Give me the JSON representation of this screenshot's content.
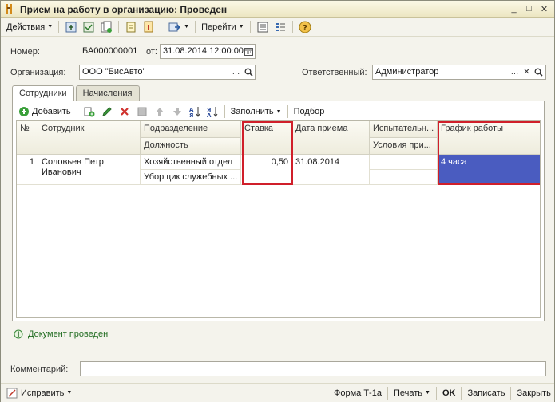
{
  "window": {
    "title": "Прием на работу в организацию: Проведен"
  },
  "toolbar": {
    "actions_label": "Действия",
    "goto_label": "Перейти"
  },
  "form": {
    "number_label": "Номер:",
    "number_value": "БА000000001",
    "date_label": "от:",
    "date_value": "31.08.2014 12:00:00",
    "org_label": "Организация:",
    "org_value": "ООО \"БисАвто\"",
    "resp_label": "Ответственный:",
    "resp_value": "Администратор"
  },
  "tabs": [
    {
      "label": "Сотрудники"
    },
    {
      "label": "Начисления"
    }
  ],
  "table_toolbar": {
    "add_label": "Добавить",
    "fill_label": "Заполнить",
    "select_label": "Подбор"
  },
  "table": {
    "headers": {
      "num": "№",
      "employee": "Сотрудник",
      "department": "Подразделение",
      "position": "Должность",
      "rate": "Ставка",
      "hire_date": "Дата приема",
      "probation": "Испытательн...",
      "conditions": "Условия при...",
      "schedule": "График работы"
    },
    "rows": [
      {
        "num": "1",
        "employee_line1": "Соловьев Петр",
        "employee_line2": "Иванович",
        "department": "Хозяйственный отдел",
        "position": "Уборщик служебных ...",
        "rate": "0,50",
        "hire_date": "31.08.2014",
        "probation": "",
        "conditions": "",
        "schedule": "4 часа"
      }
    ]
  },
  "status": {
    "text": "Документ проведен"
  },
  "comment": {
    "label": "Комментарий:",
    "value": ""
  },
  "bottom": {
    "fix_label": "Исправить",
    "form_label": "Форма Т-1а",
    "print_label": "Печать",
    "ok_label": "OK",
    "save_label": "Записать",
    "close_label": "Закрыть"
  },
  "colors": {
    "highlight": "#d01f2a",
    "selection": "#4a5cc0",
    "status_green": "#1f6b1f"
  }
}
